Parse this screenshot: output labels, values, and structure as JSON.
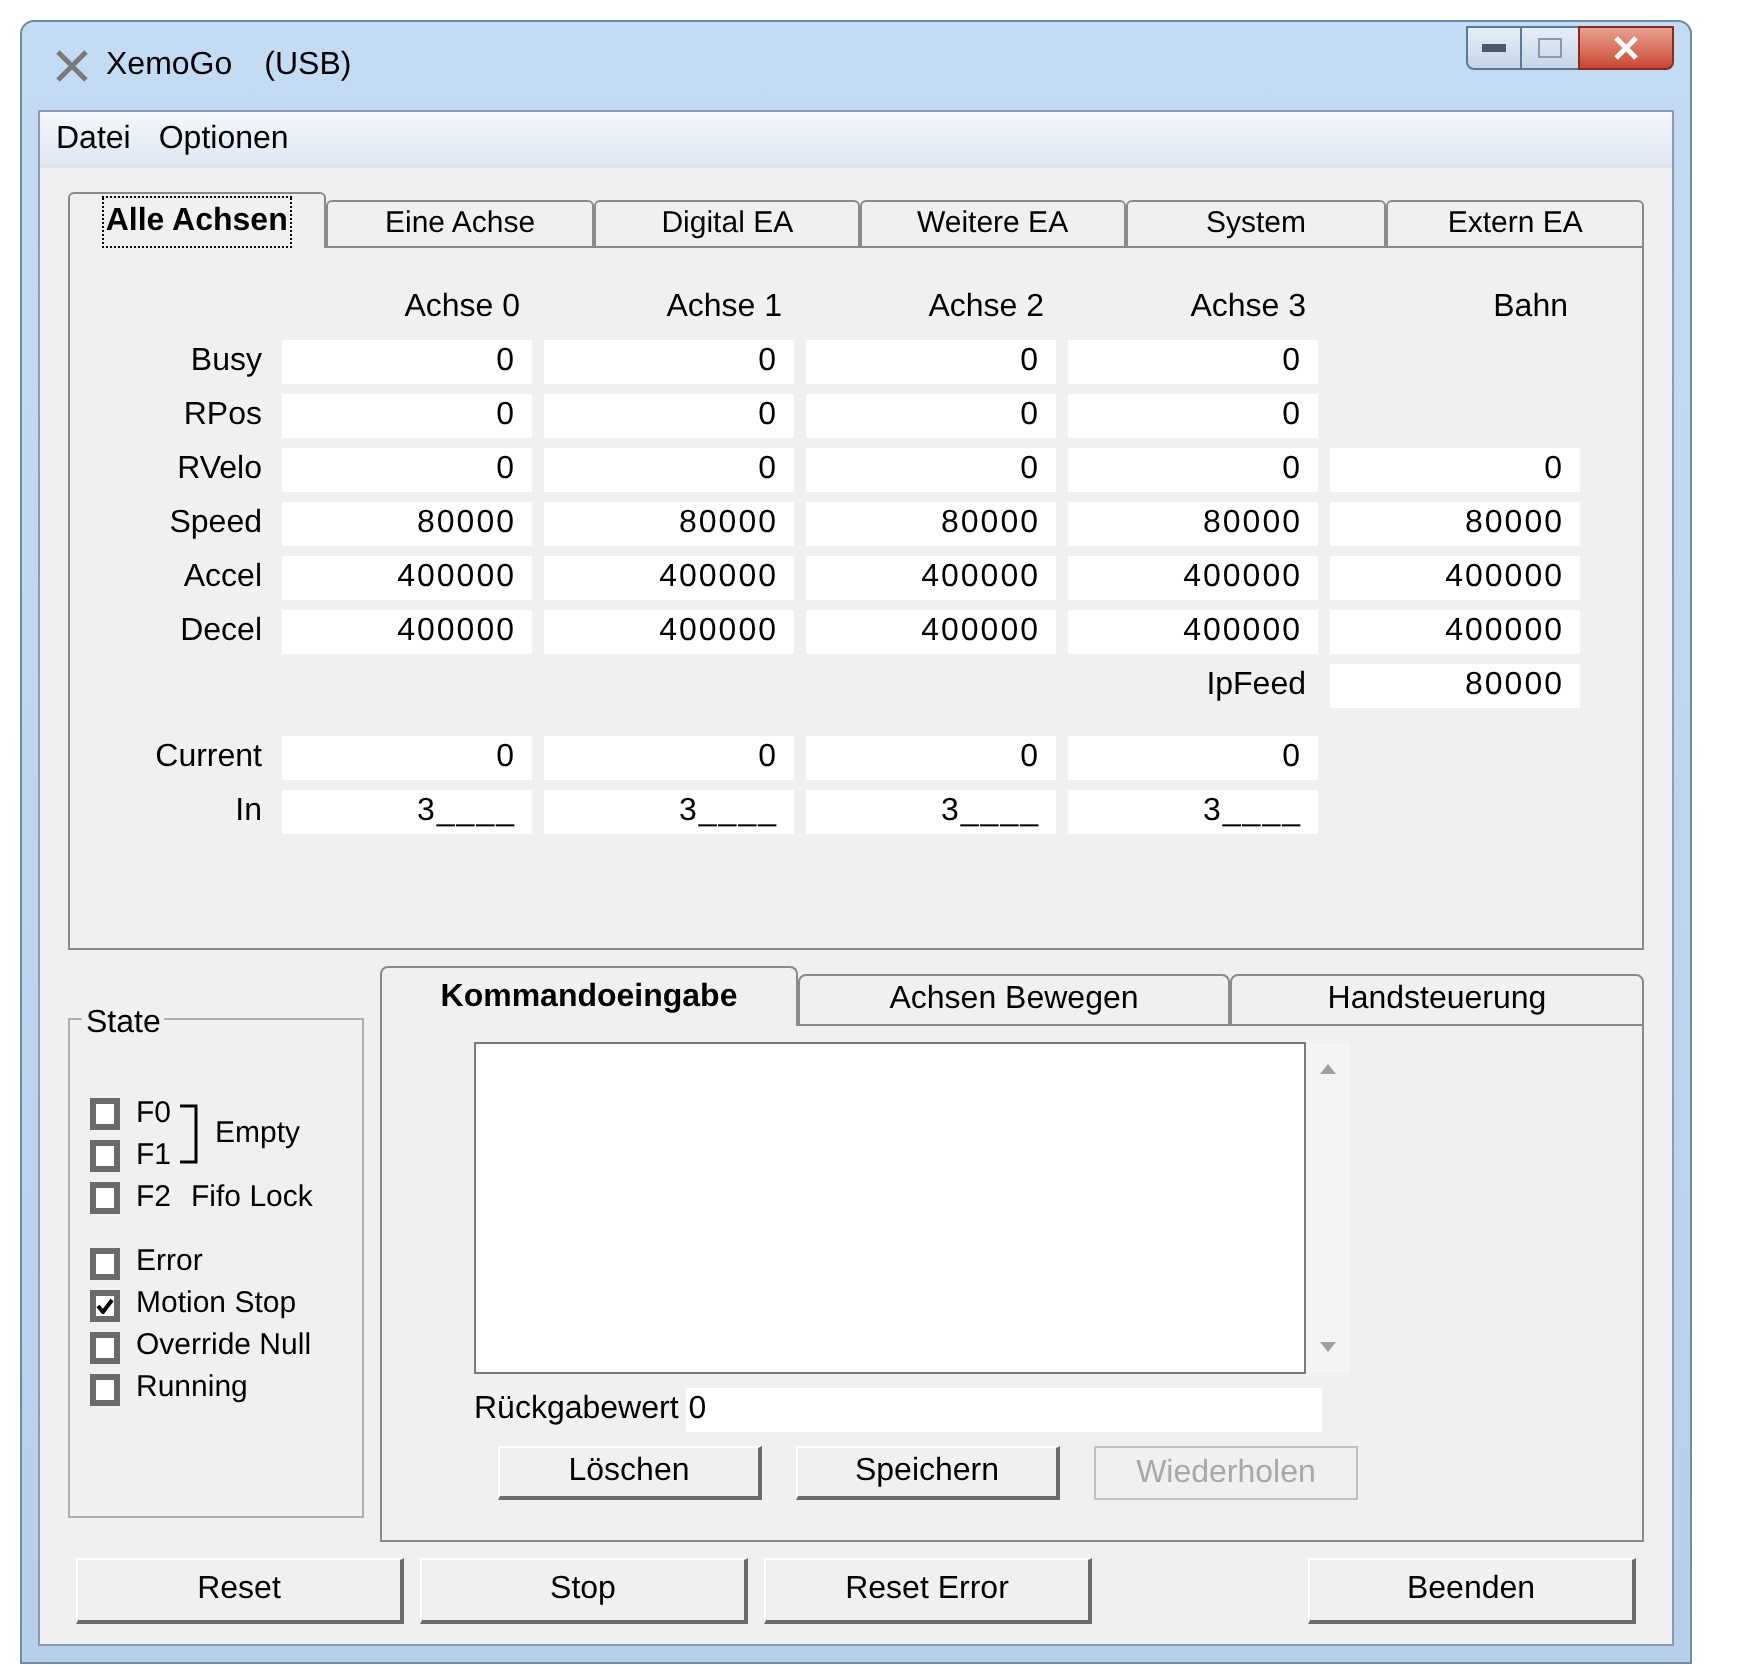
{
  "window": {
    "title": "XemoGo",
    "connection": "(USB)"
  },
  "menu": [
    "Datei",
    "Optionen"
  ],
  "tabs": [
    {
      "label": "Alle Achsen",
      "selected": true
    },
    {
      "label": "Eine Achse",
      "selected": false
    },
    {
      "label": "Digital EA",
      "selected": false
    },
    {
      "label": "Weitere EA",
      "selected": false
    },
    {
      "label": "System",
      "selected": false
    },
    {
      "label": "Extern EA",
      "selected": false
    }
  ],
  "grid": {
    "columns": [
      "Achse 0",
      "Achse 1",
      "Achse 2",
      "Achse 3",
      "Bahn"
    ],
    "sections": [
      [
        {
          "kind": "axes",
          "label": "Busy",
          "cells": [
            "0",
            "0",
            "0",
            "0"
          ]
        },
        {
          "kind": "axes",
          "label": "RPos",
          "cells": [
            "0",
            "0",
            "0",
            "0"
          ]
        },
        {
          "kind": "axes",
          "label": "RVelo",
          "cells": [
            "0",
            "0",
            "0",
            "0",
            "0"
          ]
        },
        {
          "kind": "axes",
          "label": "Speed",
          "cells": [
            "80000",
            "80000",
            "80000",
            "80000",
            "80000"
          ]
        },
        {
          "kind": "axes",
          "label": "Accel",
          "cells": [
            "400000",
            "400000",
            "400000",
            "400000",
            "400000"
          ]
        },
        {
          "kind": "axes",
          "label": "Decel",
          "cells": [
            "400000",
            "400000",
            "400000",
            "400000",
            "400000"
          ]
        },
        {
          "kind": "path",
          "label": "IpFeed",
          "cells": [
            "80000"
          ]
        }
      ],
      [
        {
          "kind": "axes",
          "label": "Current",
          "cells": [
            "0",
            "0",
            "0",
            "0"
          ]
        },
        {
          "kind": "axes",
          "label": "In",
          "cells": [
            "3____",
            "3____",
            "3____",
            "3____"
          ]
        }
      ]
    ]
  },
  "state": {
    "title": "State",
    "fifo": [
      {
        "label": "F0",
        "checked": false
      },
      {
        "label": "F1",
        "checked": false
      },
      {
        "label": "F2",
        "checked": false
      }
    ],
    "empty_label": "Empty",
    "lock_label": "Fifo Lock",
    "flags": [
      {
        "label": "Error",
        "checked": false
      },
      {
        "label": "Motion Stop",
        "checked": true
      },
      {
        "label": "Override Null",
        "checked": false
      },
      {
        "label": "Running",
        "checked": false
      }
    ]
  },
  "lower_tabs": [
    {
      "label": "Kommandoeingabe",
      "selected": true
    },
    {
      "label": "Achsen Bewegen",
      "selected": false
    },
    {
      "label": "Handsteuerung",
      "selected": false
    }
  ],
  "return_value": {
    "label": "Rückgabewert",
    "value": "0"
  },
  "command_buttons": [
    {
      "label": "Löschen",
      "disabled": false
    },
    {
      "label": "Speichern",
      "disabled": false
    },
    {
      "label": "Wiederholen",
      "disabled": true
    }
  ],
  "bottom_buttons": {
    "left": [
      "Reset",
      "Stop",
      "Reset Error"
    ],
    "right": [
      "Beenden"
    ]
  }
}
